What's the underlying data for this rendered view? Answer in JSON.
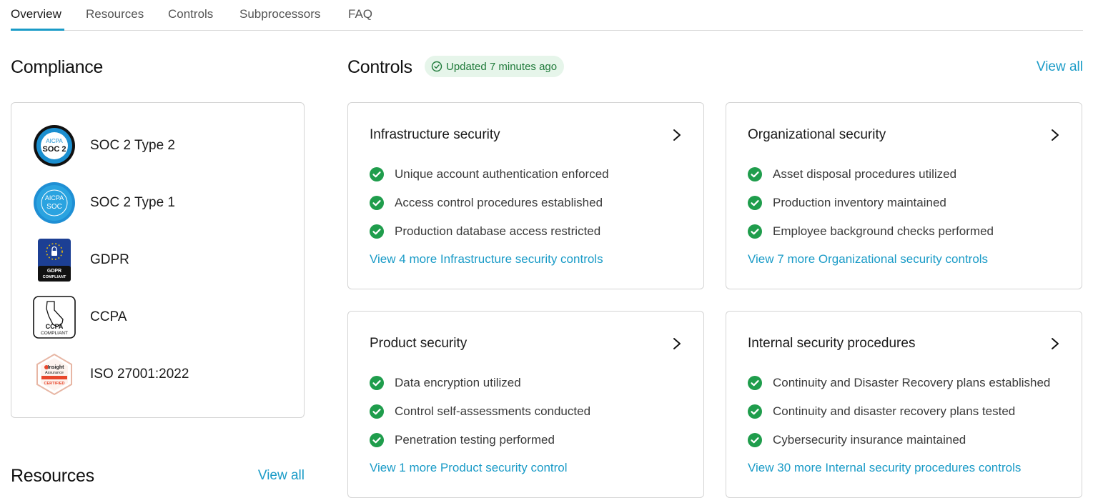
{
  "tabs": [
    {
      "label": "Overview",
      "active": true
    },
    {
      "label": "Resources",
      "active": false
    },
    {
      "label": "Controls",
      "active": false
    },
    {
      "label": "Subprocessors",
      "active": false
    },
    {
      "label": "FAQ",
      "active": false
    }
  ],
  "compliance": {
    "title": "Compliance",
    "items": [
      {
        "label": "SOC 2 Type 2",
        "icon": "aicpa-soc2-icon"
      },
      {
        "label": "SOC 2 Type 1",
        "icon": "aicpa-soc-icon"
      },
      {
        "label": "GDPR",
        "icon": "gdpr-compliant-icon"
      },
      {
        "label": "CCPA",
        "icon": "ccpa-compliant-icon"
      },
      {
        "label": "ISO 27001:2022",
        "icon": "insight-assurance-certified-icon"
      }
    ],
    "logos": {
      "aicpa_soc2": {
        "top": "AICPA",
        "bottom": "SOC 2"
      },
      "aicpa_soc": {
        "top": "AICPA",
        "bottom": "SOC"
      },
      "gdpr": {
        "line1": "GDPR",
        "line2": "COMPLIANT"
      },
      "ccpa": {
        "line1": "CCPA",
        "line2": "COMPLIANT"
      },
      "iso": {
        "line1": "Insight",
        "line2": "Assurance",
        "line3": "CERTIFIED"
      }
    }
  },
  "resources": {
    "title": "Resources",
    "view_all": "View all"
  },
  "controls": {
    "title": "Controls",
    "badge": "Updated 7 minutes ago",
    "view_all": "View all",
    "cards": [
      {
        "title": "Infrastructure security",
        "items": [
          "Unique account authentication enforced",
          "Access control procedures established",
          "Production database access restricted"
        ],
        "link": "View 4 more Infrastructure security controls"
      },
      {
        "title": "Organizational security",
        "items": [
          "Asset disposal procedures utilized",
          "Production inventory maintained",
          "Employee background checks performed"
        ],
        "link": "View 7 more Organizational security controls"
      },
      {
        "title": "Product security",
        "items": [
          "Data encryption utilized",
          "Control self-assessments conducted",
          "Penetration testing performed"
        ],
        "link": "View 1 more Product security control"
      },
      {
        "title": "Internal security procedures",
        "items": [
          "Continuity and Disaster Recovery plans established",
          "Continuity and disaster recovery plans tested",
          "Cybersecurity insurance maintained"
        ],
        "link": "View 30 more Internal security procedures controls"
      }
    ]
  },
  "colors": {
    "accent": "#1a9bc7",
    "check": "#1f9d4c",
    "badge_bg": "#e6f5ea",
    "badge_text": "#1f7a3a"
  }
}
